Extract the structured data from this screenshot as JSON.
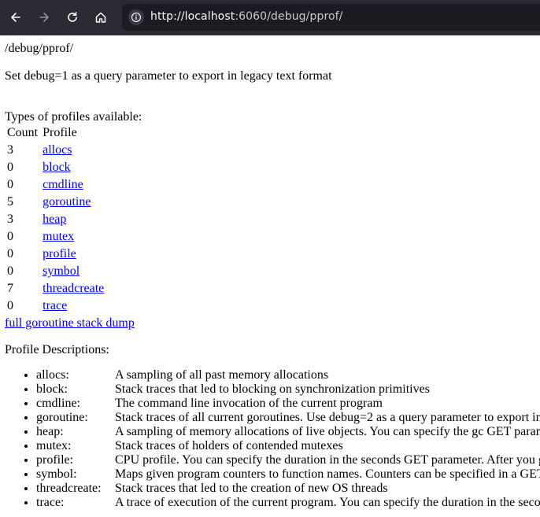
{
  "browser": {
    "url_host": "http://localhost",
    "url_rest": ":6060/debug/pprof/"
  },
  "page": {
    "heading": "/debug/pprof/",
    "legacy_note": "Set debug=1 as a query parameter to export in legacy text format",
    "types_label": "Types of profiles available:",
    "table_headers": [
      "Count",
      "Profile"
    ],
    "profiles": [
      {
        "count": "3",
        "name": "allocs"
      },
      {
        "count": "0",
        "name": "block"
      },
      {
        "count": "0",
        "name": "cmdline"
      },
      {
        "count": "5",
        "name": "goroutine"
      },
      {
        "count": "3",
        "name": "heap"
      },
      {
        "count": "0",
        "name": "mutex"
      },
      {
        "count": "0",
        "name": "profile"
      },
      {
        "count": "0",
        "name": "symbol"
      },
      {
        "count": "7",
        "name": "threadcreate"
      },
      {
        "count": "0",
        "name": "trace"
      }
    ],
    "full_dump_link": "full goroutine stack dump",
    "descriptions_label": "Profile Descriptions:",
    "descriptions": [
      {
        "key": "allocs:",
        "text": "A sampling of all past memory allocations"
      },
      {
        "key": "block:",
        "text": "Stack traces that led to blocking on synchronization primitives"
      },
      {
        "key": "cmdline:",
        "text": "The command line invocation of the current program"
      },
      {
        "key": "goroutine:",
        "text": "Stack traces of all current goroutines. Use debug=2 as a query parameter to export in"
      },
      {
        "key": "heap:",
        "text": "A sampling of memory allocations of live objects. You can specify the gc GET param"
      },
      {
        "key": "mutex:",
        "text": "Stack traces of holders of contended mutexes"
      },
      {
        "key": "profile:",
        "text": "CPU profile. You can specify the duration in the seconds GET parameter. After you g"
      },
      {
        "key": "symbol:",
        "text": "Maps given program counters to function names. Counters can be specified in a GET"
      },
      {
        "key": "threadcreate:",
        "text": "Stack traces that led to the creation of new OS threads"
      },
      {
        "key": "trace:",
        "text": "A trace of execution of the current program. You can specify the duration in the seco"
      }
    ]
  }
}
